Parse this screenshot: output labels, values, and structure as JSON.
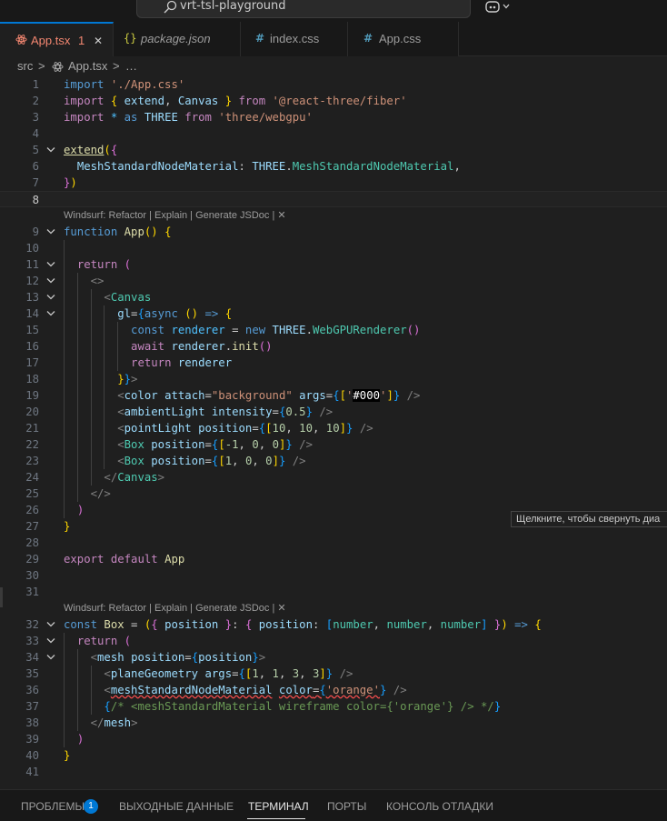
{
  "window": {
    "search_text": "vrt-tsl-playground"
  },
  "tabs": [
    {
      "label": "App.tsx",
      "icon": "react-icon",
      "problems": "1",
      "close": "✕",
      "active": true,
      "color": "#f48771"
    },
    {
      "label": "package.json",
      "icon": "braces-icon",
      "icon_text": "{}",
      "active": false
    },
    {
      "label": "index.css",
      "icon": "hash-icon",
      "icon_text": "#",
      "active": false
    },
    {
      "label": "App.css",
      "icon": "hash-icon",
      "icon_text": "#",
      "active": false
    }
  ],
  "breadcrumb": {
    "folder": "src",
    "file": "App.tsx",
    "more": "…",
    "separator": ">"
  },
  "codelens": {
    "text": "Windsurf: Refactor | Explain | Generate JSDoc | ✕",
    "before_lines": [
      9,
      32
    ]
  },
  "current_line": 8,
  "lines": [
    {
      "n": "1",
      "t": [
        [
          "kw",
          "import "
        ],
        [
          "str",
          "'./App.css'"
        ]
      ]
    },
    {
      "n": "2",
      "t": [
        [
          "ctl",
          "import "
        ],
        [
          "br1",
          "{ "
        ],
        [
          "var",
          "extend"
        ],
        [
          "def",
          ", "
        ],
        [
          "var",
          "Canvas"
        ],
        [
          "br1",
          " }"
        ],
        [
          "ctl",
          " from "
        ],
        [
          "str",
          "'@react-three/fiber'"
        ]
      ]
    },
    {
      "n": "3",
      "t": [
        [
          "ctl",
          "import "
        ],
        [
          "cnst",
          "* "
        ],
        [
          "kw",
          "as "
        ],
        [
          "var",
          "THREE"
        ],
        [
          "ctl",
          " from "
        ],
        [
          "str",
          "'three/webgpu'"
        ]
      ]
    },
    {
      "n": "4",
      "t": []
    },
    {
      "n": "5",
      "fold": true,
      "t": [
        [
          "fnu",
          "extend"
        ],
        [
          "br1",
          "("
        ],
        [
          "br2",
          "{"
        ]
      ]
    },
    {
      "n": "6",
      "t": [
        [
          "def",
          "  "
        ],
        [
          "var",
          "MeshStandardNodeMaterial"
        ],
        [
          "def",
          ": "
        ],
        [
          "var",
          "THREE"
        ],
        [
          "def",
          "."
        ],
        [
          "cls",
          "MeshStandardNodeMaterial"
        ],
        [
          "def",
          ","
        ]
      ]
    },
    {
      "n": "7",
      "t": [
        [
          "br2",
          "}"
        ],
        [
          "br1",
          ")"
        ]
      ]
    },
    {
      "n": "8",
      "t": []
    },
    {
      "n": "9",
      "fold": true,
      "t": [
        [
          "kw",
          "function "
        ],
        [
          "fn",
          "App"
        ],
        [
          "br1",
          "() "
        ],
        [
          "br1",
          "{"
        ]
      ]
    },
    {
      "n": "10",
      "t": []
    },
    {
      "n": "11",
      "fold": true,
      "t": [
        [
          "def",
          "  "
        ],
        [
          "ctl",
          "return "
        ],
        [
          "br2",
          "("
        ]
      ]
    },
    {
      "n": "12",
      "fold": true,
      "t": [
        [
          "def",
          "    "
        ],
        [
          "pun",
          "<>"
        ]
      ]
    },
    {
      "n": "13",
      "fold": true,
      "t": [
        [
          "def",
          "      "
        ],
        [
          "pun",
          "<"
        ],
        [
          "tag",
          "Canvas"
        ]
      ]
    },
    {
      "n": "14",
      "fold": true,
      "t": [
        [
          "def",
          "        "
        ],
        [
          "var",
          "gl"
        ],
        [
          "def",
          "="
        ],
        [
          "br3",
          "{"
        ],
        [
          "kw",
          "async "
        ],
        [
          "br1",
          "() "
        ],
        [
          "kw",
          "=> "
        ],
        [
          "br1",
          "{"
        ]
      ]
    },
    {
      "n": "15",
      "t": [
        [
          "def",
          "          "
        ],
        [
          "kw",
          "const "
        ],
        [
          "cnst",
          "renderer"
        ],
        [
          "def",
          " = "
        ],
        [
          "kw",
          "new "
        ],
        [
          "var",
          "THREE"
        ],
        [
          "def",
          "."
        ],
        [
          "cls",
          "WebGPURenderer"
        ],
        [
          "br2",
          "()"
        ]
      ]
    },
    {
      "n": "16",
      "t": [
        [
          "def",
          "          "
        ],
        [
          "ctl",
          "await "
        ],
        [
          "var",
          "renderer"
        ],
        [
          "def",
          "."
        ],
        [
          "fn",
          "init"
        ],
        [
          "br2",
          "()"
        ]
      ]
    },
    {
      "n": "17",
      "t": [
        [
          "def",
          "          "
        ],
        [
          "ctl",
          "return "
        ],
        [
          "var",
          "renderer"
        ]
      ]
    },
    {
      "n": "18",
      "t": [
        [
          "def",
          "        "
        ],
        [
          "br1",
          "}"
        ],
        [
          "br3",
          "}"
        ],
        [
          "pun",
          ">"
        ]
      ]
    },
    {
      "n": "19",
      "t": [
        [
          "def",
          "        "
        ],
        [
          "pun",
          "<"
        ],
        [
          "var",
          "color"
        ],
        [
          "def",
          " "
        ],
        [
          "var",
          "attach"
        ],
        [
          "def",
          "="
        ],
        [
          "str",
          "\"background\""
        ],
        [
          "def",
          " "
        ],
        [
          "var",
          "args"
        ],
        [
          "def",
          "="
        ],
        [
          "br3",
          "{"
        ],
        [
          "br1",
          "["
        ],
        [
          "str",
          "'"
        ],
        [
          "hex",
          "#000"
        ],
        [
          "str",
          "'"
        ],
        [
          "br1",
          "]"
        ],
        [
          "br3",
          "}"
        ],
        [
          "pun",
          " />"
        ]
      ]
    },
    {
      "n": "20",
      "t": [
        [
          "def",
          "        "
        ],
        [
          "pun",
          "<"
        ],
        [
          "var",
          "ambientLight"
        ],
        [
          "def",
          " "
        ],
        [
          "var",
          "intensity"
        ],
        [
          "def",
          "="
        ],
        [
          "br3",
          "{"
        ],
        [
          "num",
          "0.5"
        ],
        [
          "br3",
          "}"
        ],
        [
          "pun",
          " />"
        ]
      ]
    },
    {
      "n": "21",
      "t": [
        [
          "def",
          "        "
        ],
        [
          "pun",
          "<"
        ],
        [
          "var",
          "pointLight"
        ],
        [
          "def",
          " "
        ],
        [
          "var",
          "position"
        ],
        [
          "def",
          "="
        ],
        [
          "br3",
          "{"
        ],
        [
          "br1",
          "["
        ],
        [
          "num",
          "10"
        ],
        [
          "def",
          ", "
        ],
        [
          "num",
          "10"
        ],
        [
          "def",
          ", "
        ],
        [
          "num",
          "10"
        ],
        [
          "br1",
          "]"
        ],
        [
          "br3",
          "}"
        ],
        [
          "pun",
          " />"
        ]
      ]
    },
    {
      "n": "22",
      "t": [
        [
          "def",
          "        "
        ],
        [
          "pun",
          "<"
        ],
        [
          "tag",
          "Box"
        ],
        [
          "def",
          " "
        ],
        [
          "var",
          "position"
        ],
        [
          "def",
          "="
        ],
        [
          "br3",
          "{"
        ],
        [
          "br1",
          "["
        ],
        [
          "num",
          "-1"
        ],
        [
          "def",
          ", "
        ],
        [
          "num",
          "0"
        ],
        [
          "def",
          ", "
        ],
        [
          "num",
          "0"
        ],
        [
          "br1",
          "]"
        ],
        [
          "br3",
          "}"
        ],
        [
          "pun",
          " />"
        ]
      ]
    },
    {
      "n": "23",
      "t": [
        [
          "def",
          "        "
        ],
        [
          "pun",
          "<"
        ],
        [
          "tag",
          "Box"
        ],
        [
          "def",
          " "
        ],
        [
          "var",
          "position"
        ],
        [
          "def",
          "="
        ],
        [
          "br3",
          "{"
        ],
        [
          "br1",
          "["
        ],
        [
          "num",
          "1"
        ],
        [
          "def",
          ", "
        ],
        [
          "num",
          "0"
        ],
        [
          "def",
          ", "
        ],
        [
          "num",
          "0"
        ],
        [
          "br1",
          "]"
        ],
        [
          "br3",
          "}"
        ],
        [
          "pun",
          " />"
        ]
      ]
    },
    {
      "n": "24",
      "t": [
        [
          "def",
          "      "
        ],
        [
          "pun",
          "</"
        ],
        [
          "tag",
          "Canvas"
        ],
        [
          "pun",
          ">"
        ]
      ]
    },
    {
      "n": "25",
      "t": [
        [
          "def",
          "    "
        ],
        [
          "pun",
          "</>"
        ]
      ]
    },
    {
      "n": "26",
      "t": [
        [
          "def",
          "  "
        ],
        [
          "br2",
          ")"
        ]
      ]
    },
    {
      "n": "27",
      "t": [
        [
          "br1",
          "}"
        ]
      ]
    },
    {
      "n": "28",
      "t": []
    },
    {
      "n": "29",
      "t": [
        [
          "ctl",
          "export "
        ],
        [
          "ctl",
          "default "
        ],
        [
          "fn",
          "App"
        ]
      ]
    },
    {
      "n": "30",
      "t": []
    },
    {
      "n": "31",
      "t": []
    },
    {
      "n": "32",
      "fold": true,
      "t": [
        [
          "kw",
          "const "
        ],
        [
          "fn",
          "Box"
        ],
        [
          "def",
          " = "
        ],
        [
          "br1",
          "("
        ],
        [
          "br2",
          "{ "
        ],
        [
          "var",
          "position"
        ],
        [
          "br2",
          " }"
        ],
        [
          "def",
          ": "
        ],
        [
          "br2",
          "{ "
        ],
        [
          "var",
          "position"
        ],
        [
          "def",
          ": "
        ],
        [
          "br3",
          "["
        ],
        [
          "cls",
          "number"
        ],
        [
          "def",
          ", "
        ],
        [
          "cls",
          "number"
        ],
        [
          "def",
          ", "
        ],
        [
          "cls",
          "number"
        ],
        [
          "br3",
          "]"
        ],
        [
          "br2",
          " }"
        ],
        [
          "br1",
          ")"
        ],
        [
          "kw",
          " => "
        ],
        [
          "br1",
          "{"
        ]
      ]
    },
    {
      "n": "33",
      "fold": true,
      "t": [
        [
          "def",
          "  "
        ],
        [
          "ctl",
          "return "
        ],
        [
          "br2",
          "("
        ]
      ]
    },
    {
      "n": "34",
      "fold": true,
      "t": [
        [
          "def",
          "    "
        ],
        [
          "pun",
          "<"
        ],
        [
          "var",
          "mesh"
        ],
        [
          "def",
          " "
        ],
        [
          "var",
          "position"
        ],
        [
          "def",
          "="
        ],
        [
          "br3",
          "{"
        ],
        [
          "var",
          "position"
        ],
        [
          "br3",
          "}"
        ],
        [
          "pun",
          ">"
        ]
      ]
    },
    {
      "n": "35",
      "t": [
        [
          "def",
          "      "
        ],
        [
          "pun",
          "<"
        ],
        [
          "var",
          "planeGeometry"
        ],
        [
          "def",
          " "
        ],
        [
          "var",
          "args"
        ],
        [
          "def",
          "="
        ],
        [
          "br3",
          "{"
        ],
        [
          "br1",
          "["
        ],
        [
          "num",
          "1"
        ],
        [
          "def",
          ", "
        ],
        [
          "num",
          "1"
        ],
        [
          "def",
          ", "
        ],
        [
          "num",
          "3"
        ],
        [
          "def",
          ", "
        ],
        [
          "num",
          "3"
        ],
        [
          "br1",
          "]"
        ],
        [
          "br3",
          "}"
        ],
        [
          "pun",
          " />"
        ]
      ]
    },
    {
      "n": "36",
      "t": [
        [
          "def",
          "      "
        ],
        [
          "pun",
          "<"
        ],
        [
          "varsq",
          "meshStandardNodeMaterial"
        ],
        [
          "def",
          " "
        ],
        [
          "varsq",
          "color"
        ],
        [
          "defsq",
          "="
        ],
        [
          "br3sq",
          "{"
        ],
        [
          "strsq",
          "'orange'"
        ],
        [
          "br3",
          "}"
        ],
        [
          "pun",
          " />"
        ]
      ]
    },
    {
      "n": "37",
      "t": [
        [
          "def",
          "      "
        ],
        [
          "br3",
          "{"
        ],
        [
          "cmt",
          "/* <meshStandardMaterial wireframe color={'orange'} /> */"
        ],
        [
          "br3",
          "}"
        ]
      ]
    },
    {
      "n": "38",
      "t": [
        [
          "def",
          "    "
        ],
        [
          "pun",
          "</"
        ],
        [
          "var",
          "mesh"
        ],
        [
          "pun",
          ">"
        ]
      ]
    },
    {
      "n": "39",
      "t": [
        [
          "def",
          "  "
        ],
        [
          "br2",
          ")"
        ]
      ]
    },
    {
      "n": "40",
      "t": [
        [
          "br1",
          "}"
        ]
      ]
    },
    {
      "n": "41",
      "t": []
    }
  ],
  "tooltip": {
    "text": "Щелкните, чтобы свернуть диа"
  },
  "panel": {
    "tabs": [
      {
        "label": "ПРОБЛЕМЫ",
        "badge": "1"
      },
      {
        "label": "ВЫХОДНЫЕ ДАННЫЕ"
      },
      {
        "label": "ТЕРМИНАЛ",
        "active": true
      },
      {
        "label": "ПОРТЫ"
      },
      {
        "label": "КОНСОЛЬ ОТЛАДКИ"
      }
    ]
  },
  "colors": {
    "accent": "#0078d4",
    "background": "#1f1f1f",
    "error": "#f14c4c"
  }
}
